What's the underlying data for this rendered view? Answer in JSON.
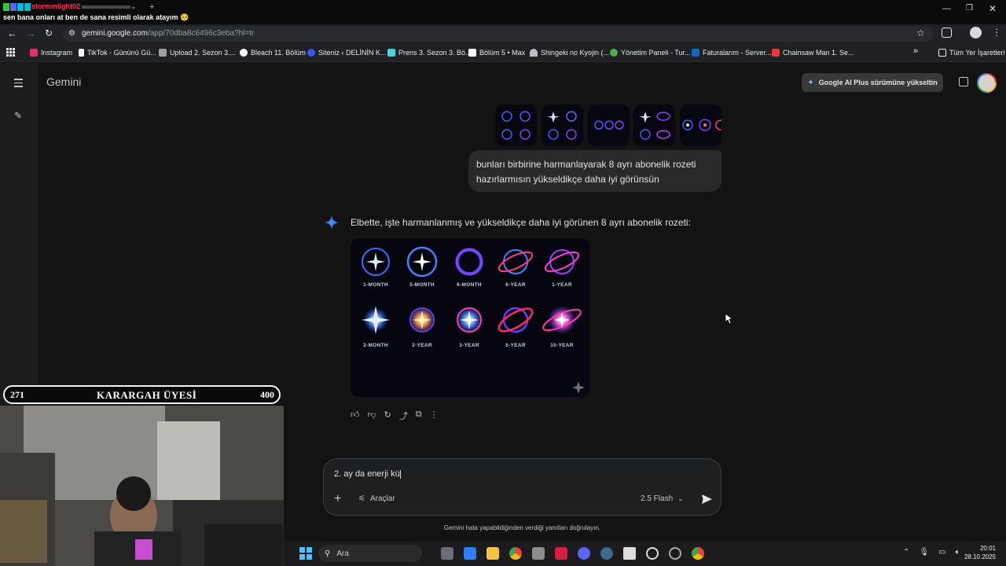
{
  "window": {
    "stream_overlay_title": "stormmlight02",
    "stream_overlay_message": "sen bana onları at ben de sana resimli olarak atayım 🥺"
  },
  "browser": {
    "url_domain": "gemini.google.com",
    "url_path": "/app/70dba8c6496c3eba?hl=tr",
    "bookmarks": [
      {
        "label": "Instagram",
        "color": "#e1306c"
      },
      {
        "label": "TikTok - Günün­ü Gü...",
        "color": "#ffffff"
      },
      {
        "label": "Upload 2. Sezon 3....",
        "color": "#9aa0a6"
      },
      {
        "label": "Bleach 11. Bölüm",
        "color": "#ffffff"
      },
      {
        "label": "Siteniz ‹ DELİNİN K...",
        "color": "#3858e9"
      },
      {
        "label": "Prens 3. Sezon 3. Bö...",
        "color": "#4dd0e1"
      },
      {
        "label": "Bölüm 5 • Max",
        "color": "#ffffff"
      },
      {
        "label": "Shingeki no Kyojin (...",
        "color": "#bdbdbd"
      },
      {
        "label": "Yönetim Paneli - Tur...",
        "color": "#4caf50"
      },
      {
        "label": "Faturalarım - Server...",
        "color": "#1565c0"
      },
      {
        "label": "Chainsaw Man 1. Se...",
        "color": "#e53935"
      }
    ],
    "all_bookmarks_label": "Tüm Yer İşaretleri"
  },
  "gemini": {
    "brand": "Gemini",
    "upgrade_button": "Google AI Plus sürümüne yükseltin",
    "user_message": "bunları birbirine harmanlayarak 8 ayrı abonelik rozeti hazırlarmısın yükseldikçe daha iyi görünsün",
    "model_reply": "Elbette, işte harmanlanmış ve yükseldikçe daha iyi görünen 8 ayrı abonelik rozeti:",
    "badges_row1": [
      "1-MONTH",
      "5-MONTH",
      "6-MONTH",
      "6-YEAR",
      "1-YEAR"
    ],
    "badges_row2": [
      "2-MONTH",
      "2-YEAR",
      "3-YEAR",
      "5-YEAR",
      "10-YEAR"
    ],
    "composer_text": "2. ay da enerji kü",
    "tools_label": "Araçlar",
    "model_selector": "2.5 Flash",
    "disclaimer": "Gemini hata yapabildiğinden verdiği yanıtları doğrulayın."
  },
  "overlay": {
    "left_count": "271",
    "title": "KARARGAH ÜYESİ",
    "right_count": "400"
  },
  "taskbar": {
    "search_placeholder": "Ara",
    "time": "20:01",
    "date": "28.10.2025"
  },
  "colors": {
    "accent_blue": "#4285f4",
    "bg": "#131314",
    "bubble": "#282a2c"
  }
}
